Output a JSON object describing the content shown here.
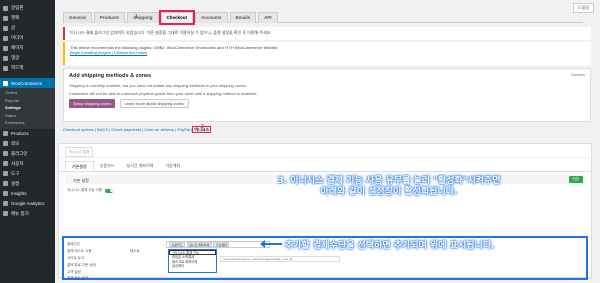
{
  "sidebar": {
    "items": [
      {
        "label": "알림판",
        "icon": "dashboard-icon"
      },
      {
        "label": "젯팩",
        "icon": "jetpack-icon"
      },
      {
        "label": "글",
        "icon": "pin-icon"
      },
      {
        "label": "미디어",
        "icon": "media-icon"
      },
      {
        "label": "페이지",
        "icon": "page-icon"
      },
      {
        "label": "댓글",
        "icon": "comment-icon"
      },
      {
        "label": "피드백",
        "icon": "feedback-icon"
      }
    ],
    "woo_label": "WooCommerce",
    "woo_sub": [
      "Orders",
      "Reports",
      "Settings",
      "Status",
      "Extensions"
    ],
    "items_after": [
      {
        "label": "Products",
        "icon": "products-icon"
      },
      {
        "label": "외모",
        "icon": "appearance-icon"
      },
      {
        "label": "플러그인",
        "icon": "plugin-icon"
      },
      {
        "label": "사용자",
        "icon": "users-icon"
      },
      {
        "label": "도구",
        "icon": "tools-icon"
      },
      {
        "label": "설정",
        "icon": "settings-icon"
      },
      {
        "label": "Insights",
        "icon": "insights-icon"
      },
      {
        "label": "Google Analytics",
        "icon": "analytics-icon"
      },
      {
        "label": "메뉴 접기",
        "icon": "collapse-icon"
      }
    ]
  },
  "screen_options": "도움말",
  "tabs": [
    "General",
    "Products",
    "Shipping",
    "Checkout",
    "Accounts",
    "Emails",
    "API"
  ],
  "active_tab_mark": "1",
  "notice1": "이니시스 결제 플러그인 업데이트 되었습니다. 기존 설정을 그대로 이용하실 수 없으니, 플랫 설정을 확인 후 이용해 주세요.",
  "notice2": {
    "text": "This theme recommends the following plugins: CMB2, WooCommerce Shortcodes and YITH WooCommerce Wishlist.",
    "links": "Begin installing plugins | Dismiss this notice"
  },
  "shipping": {
    "title": "Add shipping methods & zones",
    "line1": "Shipping is currently enabled, but you have not added any shipping methods to your shipping zones.",
    "line2": "Customers will not be able to purchase physical goods from your store until a shipping method is available.",
    "primary_btn": "Setup shipping zones",
    "secondary_btn": "Learn more about shipping zones",
    "dismiss": "Dismiss"
  },
  "subnav": {
    "links": "Checkout options | BACS | Check payments | Cash on delivery | PayPal |",
    "current": "이니시스",
    "mark": "2"
  },
  "panel": {
    "crumb": "이니시스 설정",
    "tabs": [
      "기본설정",
      "신용카드",
      "실시간 계좌이체",
      "가상계좌"
    ],
    "section_title": "기본 설정",
    "save": "저장",
    "toggle_label": "이니시스 결제 기능 사용"
  },
  "rows": [
    {
      "label": "결제수단"
    },
    {
      "label": "결제 테스트 사용"
    },
    {
      "label": "사이트 로고"
    },
    {
      "label": "결제 완료 주문 상태"
    },
    {
      "label": "고객 설정"
    },
    {
      "label": "결제 완료 문구"
    }
  ],
  "chips": [
    "신용카드",
    "실시간 계좌이체",
    "가상계좌"
  ],
  "dropdown": [
    "이니시스 결제 기능",
    "휴대폰 소액결제",
    "에스크로 계좌이체",
    "삼성페이"
  ],
  "input_hint": "/wp-content/plugins/.../assets/images/inipay_logo.gif",
  "row_value": "테스트",
  "annotation3_line1": "3. 이니시스 결제 기능 사용 유무를 눌러 \"활성화\"시켜주면",
  "annotation3_line2": "아래와 같이 설정창이 활성화됩니다.",
  "annotation4": "추가할 결제수단을 선택하면 추가되며 위에 표시됩니다.",
  "colors": {
    "accent": "#e0245e",
    "highlight": "#1e73e8",
    "woo": "#96588a",
    "wp_active": "#0073aa"
  }
}
